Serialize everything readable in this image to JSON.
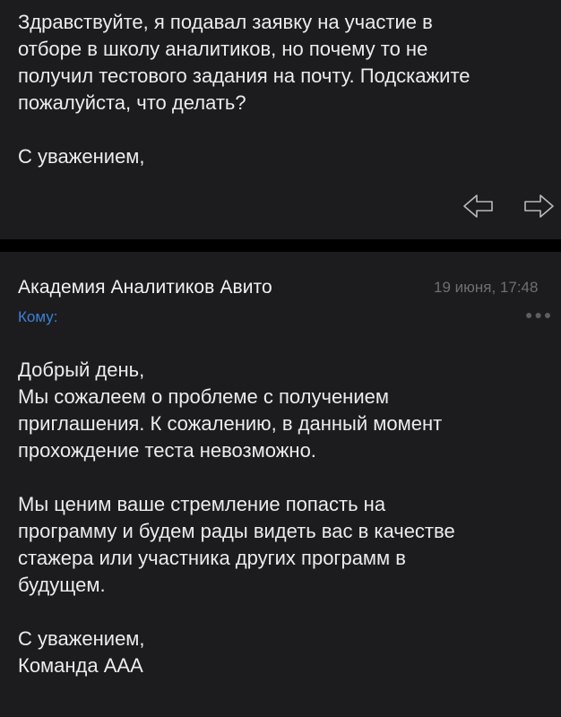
{
  "previous_message": {
    "body_lines": [
      "Здравствуйте, я подавал заявку на участие в",
      "отборе в школу аналитиков, но почему то не",
      "получил тестового задания на почту. Подскажите",
      "пожалуйста, что делать?"
    ],
    "signature": "С уважением,",
    "actions": {
      "reply_icon": "reply-arrow-icon",
      "forward_icon": "forward-arrow-icon"
    }
  },
  "reply_message": {
    "sender": "Академия Аналитиков Авито",
    "date": "19 июня, 17:48",
    "to_label": "Кому:",
    "more_icon": "ellipsis-icon",
    "paragraph1": [
      "Добрый день,",
      "Мы сожалеем о проблеме с получением",
      "приглашения. К сожалению, в данный момент",
      "прохождение теста невозможно."
    ],
    "paragraph2": [
      "Мы ценим ваше стремление попасть на",
      "программу и будем рады видеть вас в качестве",
      "стажера или участника других программ в",
      "будущем."
    ],
    "signature": [
      "С уважением,",
      "Команда ААА"
    ]
  },
  "colors": {
    "background": "#000000",
    "card": "#1c1c1e",
    "text": "#ececee",
    "muted": "#6e6e73",
    "accent": "#3d7fd6"
  }
}
